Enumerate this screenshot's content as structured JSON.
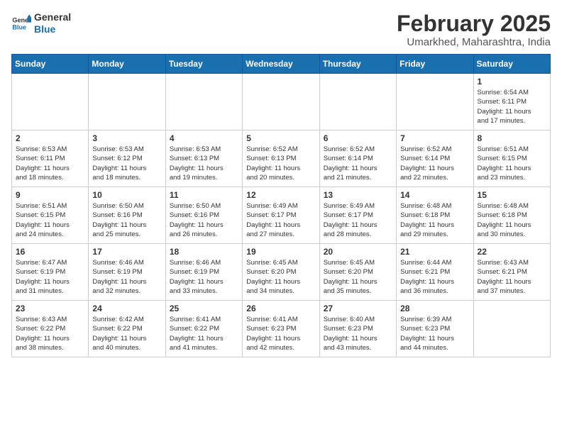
{
  "header": {
    "logo_general": "General",
    "logo_blue": "Blue",
    "month_title": "February 2025",
    "location": "Umarkhed, Maharashtra, India"
  },
  "days_of_week": [
    "Sunday",
    "Monday",
    "Tuesday",
    "Wednesday",
    "Thursday",
    "Friday",
    "Saturday"
  ],
  "weeks": [
    {
      "days": [
        {
          "num": "",
          "info": ""
        },
        {
          "num": "",
          "info": ""
        },
        {
          "num": "",
          "info": ""
        },
        {
          "num": "",
          "info": ""
        },
        {
          "num": "",
          "info": ""
        },
        {
          "num": "",
          "info": ""
        },
        {
          "num": "1",
          "info": "Sunrise: 6:54 AM\nSunset: 6:11 PM\nDaylight: 11 hours\nand 17 minutes."
        }
      ]
    },
    {
      "days": [
        {
          "num": "2",
          "info": "Sunrise: 6:53 AM\nSunset: 6:11 PM\nDaylight: 11 hours\nand 18 minutes."
        },
        {
          "num": "3",
          "info": "Sunrise: 6:53 AM\nSunset: 6:12 PM\nDaylight: 11 hours\nand 18 minutes."
        },
        {
          "num": "4",
          "info": "Sunrise: 6:53 AM\nSunset: 6:13 PM\nDaylight: 11 hours\nand 19 minutes."
        },
        {
          "num": "5",
          "info": "Sunrise: 6:52 AM\nSunset: 6:13 PM\nDaylight: 11 hours\nand 20 minutes."
        },
        {
          "num": "6",
          "info": "Sunrise: 6:52 AM\nSunset: 6:14 PM\nDaylight: 11 hours\nand 21 minutes."
        },
        {
          "num": "7",
          "info": "Sunrise: 6:52 AM\nSunset: 6:14 PM\nDaylight: 11 hours\nand 22 minutes."
        },
        {
          "num": "8",
          "info": "Sunrise: 6:51 AM\nSunset: 6:15 PM\nDaylight: 11 hours\nand 23 minutes."
        }
      ]
    },
    {
      "days": [
        {
          "num": "9",
          "info": "Sunrise: 6:51 AM\nSunset: 6:15 PM\nDaylight: 11 hours\nand 24 minutes."
        },
        {
          "num": "10",
          "info": "Sunrise: 6:50 AM\nSunset: 6:16 PM\nDaylight: 11 hours\nand 25 minutes."
        },
        {
          "num": "11",
          "info": "Sunrise: 6:50 AM\nSunset: 6:16 PM\nDaylight: 11 hours\nand 26 minutes."
        },
        {
          "num": "12",
          "info": "Sunrise: 6:49 AM\nSunset: 6:17 PM\nDaylight: 11 hours\nand 27 minutes."
        },
        {
          "num": "13",
          "info": "Sunrise: 6:49 AM\nSunset: 6:17 PM\nDaylight: 11 hours\nand 28 minutes."
        },
        {
          "num": "14",
          "info": "Sunrise: 6:48 AM\nSunset: 6:18 PM\nDaylight: 11 hours\nand 29 minutes."
        },
        {
          "num": "15",
          "info": "Sunrise: 6:48 AM\nSunset: 6:18 PM\nDaylight: 11 hours\nand 30 minutes."
        }
      ]
    },
    {
      "days": [
        {
          "num": "16",
          "info": "Sunrise: 6:47 AM\nSunset: 6:19 PM\nDaylight: 11 hours\nand 31 minutes."
        },
        {
          "num": "17",
          "info": "Sunrise: 6:46 AM\nSunset: 6:19 PM\nDaylight: 11 hours\nand 32 minutes."
        },
        {
          "num": "18",
          "info": "Sunrise: 6:46 AM\nSunset: 6:19 PM\nDaylight: 11 hours\nand 33 minutes."
        },
        {
          "num": "19",
          "info": "Sunrise: 6:45 AM\nSunset: 6:20 PM\nDaylight: 11 hours\nand 34 minutes."
        },
        {
          "num": "20",
          "info": "Sunrise: 6:45 AM\nSunset: 6:20 PM\nDaylight: 11 hours\nand 35 minutes."
        },
        {
          "num": "21",
          "info": "Sunrise: 6:44 AM\nSunset: 6:21 PM\nDaylight: 11 hours\nand 36 minutes."
        },
        {
          "num": "22",
          "info": "Sunrise: 6:43 AM\nSunset: 6:21 PM\nDaylight: 11 hours\nand 37 minutes."
        }
      ]
    },
    {
      "days": [
        {
          "num": "23",
          "info": "Sunrise: 6:43 AM\nSunset: 6:22 PM\nDaylight: 11 hours\nand 38 minutes."
        },
        {
          "num": "24",
          "info": "Sunrise: 6:42 AM\nSunset: 6:22 PM\nDaylight: 11 hours\nand 40 minutes."
        },
        {
          "num": "25",
          "info": "Sunrise: 6:41 AM\nSunset: 6:22 PM\nDaylight: 11 hours\nand 41 minutes."
        },
        {
          "num": "26",
          "info": "Sunrise: 6:41 AM\nSunset: 6:23 PM\nDaylight: 11 hours\nand 42 minutes."
        },
        {
          "num": "27",
          "info": "Sunrise: 6:40 AM\nSunset: 6:23 PM\nDaylight: 11 hours\nand 43 minutes."
        },
        {
          "num": "28",
          "info": "Sunrise: 6:39 AM\nSunset: 6:23 PM\nDaylight: 11 hours\nand 44 minutes."
        },
        {
          "num": "",
          "info": ""
        }
      ]
    }
  ]
}
